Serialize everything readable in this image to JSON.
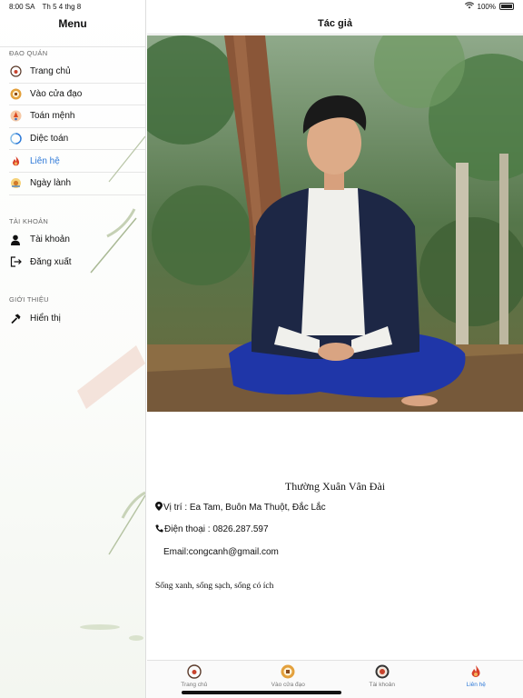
{
  "status": {
    "time": "8:00 SA",
    "date": "Th 5 4 thg 8",
    "battery": "100%"
  },
  "sidebar": {
    "title": "Menu",
    "sections": [
      {
        "title": "ĐẠO QUÁN",
        "items": [
          {
            "label": "Trang chủ",
            "icon": "home-logo-icon"
          },
          {
            "label": "Vào cửa đạo",
            "icon": "gate-icon"
          },
          {
            "label": "Toán mệnh",
            "icon": "fortune-icon"
          },
          {
            "label": "Diệc toán",
            "icon": "divination-icon"
          },
          {
            "label": "Liên hệ",
            "icon": "flame-icon",
            "active": true
          },
          {
            "label": "Ngày lành",
            "icon": "calendar-sun-icon"
          }
        ]
      },
      {
        "title": "TÀI KHOẢN",
        "items": [
          {
            "label": "Tài khoản",
            "icon": "user-icon"
          },
          {
            "label": "Đăng xuất",
            "icon": "logout-icon"
          }
        ]
      },
      {
        "title": "GIỚI THIỆU",
        "items": [
          {
            "label": "Hiển thị",
            "icon": "hammer-icon"
          }
        ]
      }
    ]
  },
  "main": {
    "title": "Tác giả",
    "author_name": "Thường Xuân Vân Đài",
    "location": "Vị trí : Ea Tam, Buôn Ma Thuột, Đắc Lắc",
    "phone": "Điện thoại : 0826.287.597",
    "email": "Email:congcanh@gmail.com",
    "motto": "Sống xanh, sống sạch, sống có ích"
  },
  "tabbar": {
    "tabs": [
      {
        "label": "Trang chủ",
        "icon": "home-logo-icon"
      },
      {
        "label": "Vào cửa đạo",
        "icon": "gate-icon"
      },
      {
        "label": "Tài khoản",
        "icon": "account-icon"
      },
      {
        "label": "Liên hệ",
        "icon": "flame-icon",
        "active": true
      }
    ]
  },
  "colors": {
    "accent": "#2f7ad8",
    "text": "#111111",
    "divider": "#e2e2e2"
  }
}
